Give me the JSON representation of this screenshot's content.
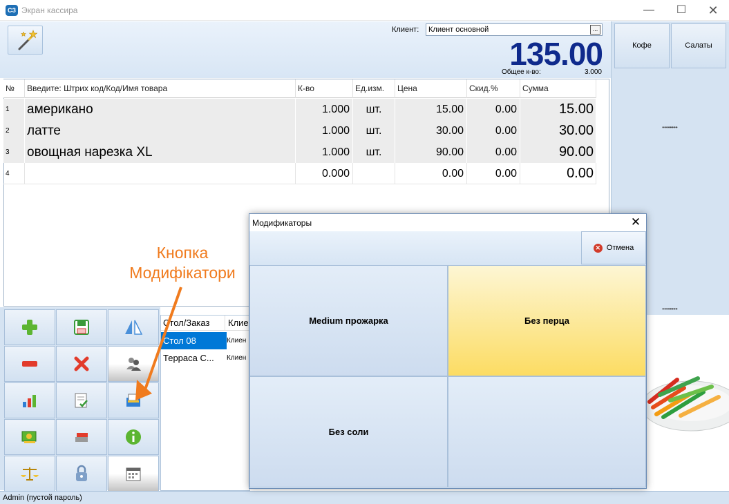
{
  "window": {
    "title": "Экран кассира",
    "logo_text": "СЗ"
  },
  "top": {
    "client_label": "Клиент:",
    "client_value": "Клиент основной",
    "client_dots": "...",
    "total": "135.00",
    "qty_label": "Общее к-во:",
    "qty_value": "3.000"
  },
  "categories": [
    "Кофе",
    "Салаты"
  ],
  "grid": {
    "headers": [
      "№",
      "Введите: Штрих код/Код/Имя товара",
      "К-во",
      "Ед.изм.",
      "Цена",
      "Скид.%",
      "Сумма"
    ],
    "rows": [
      {
        "no": "1",
        "name": "американо",
        "qty": "1.000",
        "unit": "шт.",
        "price": "15.00",
        "disc": "0.00",
        "sum": "15.00"
      },
      {
        "no": "2",
        "name": "латте",
        "qty": "1.000",
        "unit": "шт.",
        "price": "30.00",
        "disc": "0.00",
        "sum": "30.00"
      },
      {
        "no": "3",
        "name": "овощная нарезка XL",
        "qty": "1.000",
        "unit": "шт.",
        "price": "90.00",
        "disc": "0.00",
        "sum": "90.00"
      },
      {
        "no": "4",
        "name": "",
        "qty": "0.000",
        "unit": "",
        "price": "0.00",
        "disc": "0.00",
        "sum": "0.00"
      }
    ]
  },
  "orders": {
    "header_table": "Стол/Заказ",
    "header_client": "Клие",
    "rows": [
      {
        "table": "Стол 08",
        "client": "Клиен"
      },
      {
        "table": "Терраса С...",
        "client": "Клиен"
      }
    ]
  },
  "annotation": {
    "line1": "Кнопка",
    "line2": "Модифікатори"
  },
  "status": {
    "text": "Admin (пустой пароль)"
  },
  "modal": {
    "title": "Модификаторы",
    "cancel_label": "Отмена",
    "buttons": [
      "Medium прожарка",
      "Без перца",
      "Без соли",
      ""
    ]
  },
  "colors": {
    "accent_total": "#0f2a8c",
    "annotation": "#f07b1e",
    "selected_row": "#0078d7",
    "highlight_button": "#fcdc63"
  }
}
